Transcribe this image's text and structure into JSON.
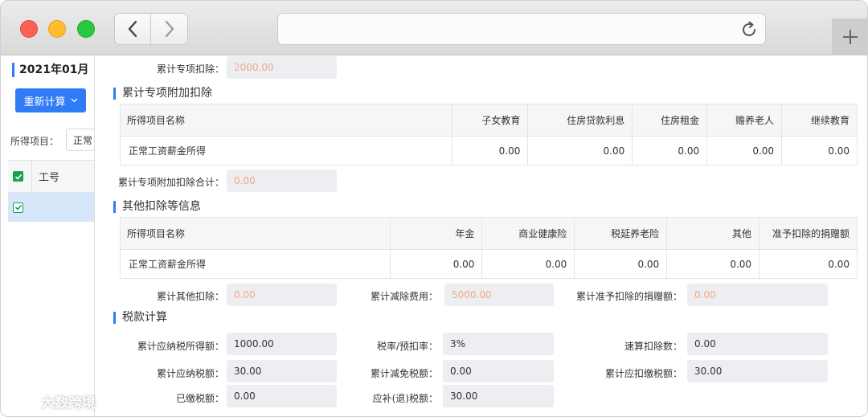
{
  "browser": {
    "back_icon": "chevron-left-icon",
    "forward_icon": "chevron-right-icon",
    "reload_icon": "reload-icon",
    "new_tab_icon": "plus-icon"
  },
  "left": {
    "period": "2021年01月",
    "recalc_label": "重新计算",
    "item_label": "所得项目：",
    "item_value": "正常",
    "col_emp_no": "工号"
  },
  "top_fields": {
    "cum_special_deduction_label": "累计专项扣除：",
    "cum_special_deduction_value": "2000.00"
  },
  "sec_special": {
    "title": "累计专项附加扣除",
    "headers": [
      "所得项目名称",
      "子女教育",
      "住房贷款利息",
      "住房租金",
      "赡养老人",
      "继续教育"
    ],
    "rows": [
      [
        "正常工资薪金所得",
        "0.00",
        "0.00",
        "0.00",
        "0.00",
        "0.00"
      ]
    ],
    "total_label": "累计专项附加扣除合计：",
    "total_value": "0.00"
  },
  "sec_other": {
    "title": "其他扣除等信息",
    "headers": [
      "所得项目名称",
      "年金",
      "商业健康险",
      "税延养老险",
      "其他",
      "准予扣除的捐赠额"
    ],
    "rows": [
      [
        "正常工资薪金所得",
        "0.00",
        "0.00",
        "0.00",
        "0.00",
        "0.00"
      ]
    ],
    "cum_other_label": "累计其他扣除：",
    "cum_other_value": "0.00",
    "cum_reduction_label": "累计减除费用：",
    "cum_reduction_value": "5000.00",
    "cum_donation_label": "累计准予扣除的捐赠额：",
    "cum_donation_value": "0.00"
  },
  "tax": {
    "title": "税款计算",
    "taxable_income_label": "累计应纳税所得额：",
    "taxable_income_value": "1000.00",
    "rate_label": "税率/预扣率：",
    "rate_value": "3%",
    "quick_deduction_label": "速算扣除数：",
    "quick_deduction_value": "0.00",
    "tax_payable_label": "累计应纳税额：",
    "tax_payable_value": "30.00",
    "tax_relief_label": "累计减免税额：",
    "tax_relief_value": "0.00",
    "tax_withheld_label": "累计应扣缴税额：",
    "tax_withheld_value": "30.00",
    "tax_paid_label": "已缴税额：",
    "tax_paid_value": "0.00",
    "tax_due_label": "应补(退)税额：",
    "tax_due_value": "30.00"
  },
  "watermark": "大数跨境",
  "colors": {
    "accent": "#2f7cf6",
    "check": "#17a34a",
    "muted_value": "#f0a98a"
  }
}
